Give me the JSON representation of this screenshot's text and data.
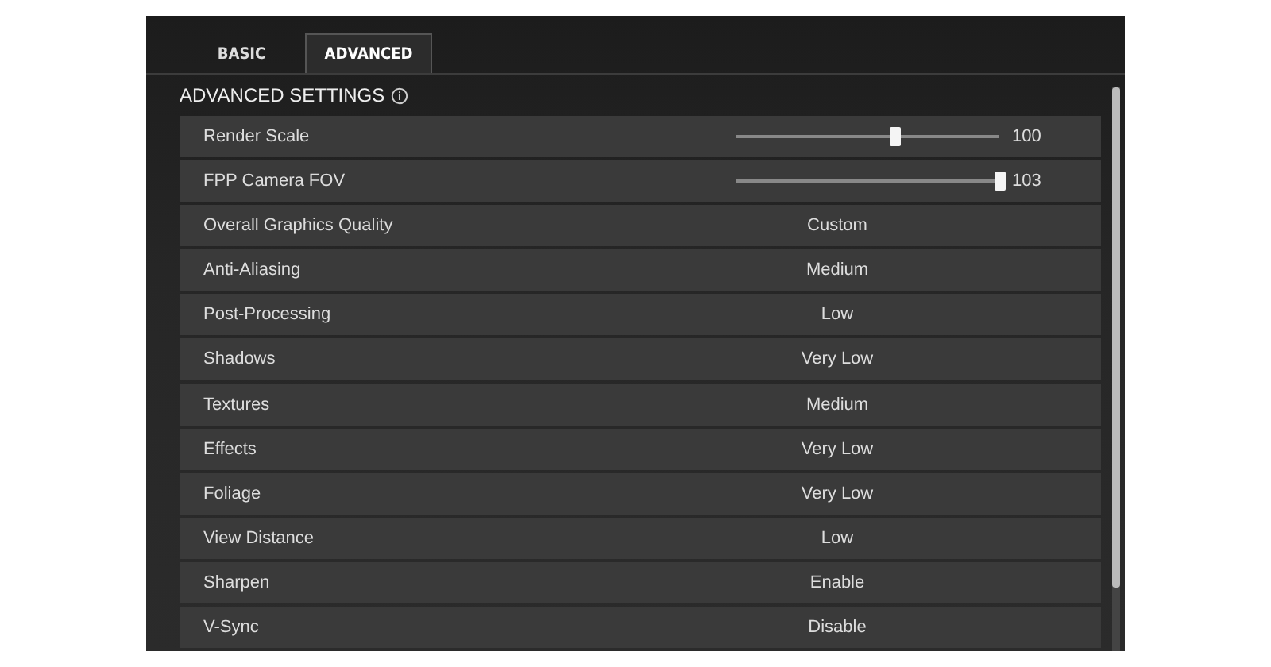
{
  "tabs": [
    {
      "label": "BASIC",
      "selected": false
    },
    {
      "label": "ADVANCED",
      "selected": true
    }
  ],
  "section_title": "ADVANCED SETTINGS",
  "settings": [
    {
      "kind": "slider",
      "label": "Render Scale",
      "level": 0.6,
      "value": "100"
    },
    {
      "kind": "slider",
      "label": "FPP Camera FOV",
      "level": 1.0,
      "value": "103"
    },
    {
      "kind": "option",
      "label": "Overall Graphics Quality",
      "value": "Custom"
    },
    {
      "kind": "option",
      "label": "Anti-Aliasing",
      "value": "Medium"
    },
    {
      "kind": "option",
      "label": "Post-Processing",
      "value": "Low"
    },
    {
      "kind": "option",
      "label": "Shadows",
      "value": "Very Low"
    },
    {
      "kind": "option",
      "label": "Textures",
      "value": "Medium"
    },
    {
      "kind": "option",
      "label": "Effects",
      "value": "Very Low"
    },
    {
      "kind": "option",
      "label": "Foliage",
      "value": "Very Low"
    },
    {
      "kind": "option",
      "label": "View Distance",
      "value": "Low"
    },
    {
      "kind": "option",
      "label": "Sharpen",
      "value": "Enable"
    },
    {
      "kind": "option",
      "label": "V-Sync",
      "value": "Disable"
    }
  ]
}
